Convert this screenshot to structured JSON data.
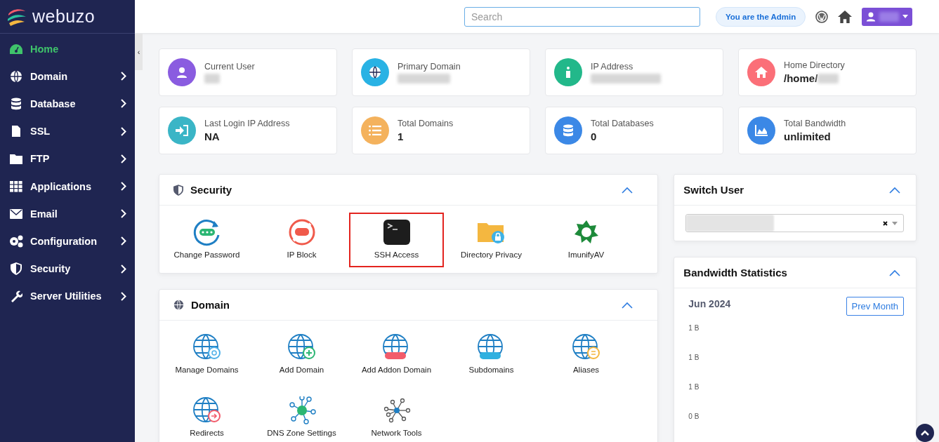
{
  "sidebar": {
    "logo": "webuzo",
    "collapse": "‹",
    "items": [
      {
        "label": "Home",
        "selected": true,
        "expandable": false
      },
      {
        "label": "Domain",
        "selected": false,
        "expandable": true
      },
      {
        "label": "Database",
        "selected": false,
        "expandable": true
      },
      {
        "label": "SSL",
        "selected": false,
        "expandable": true
      },
      {
        "label": "FTP",
        "selected": false,
        "expandable": true
      },
      {
        "label": "Applications",
        "selected": false,
        "expandable": true
      },
      {
        "label": "Email",
        "selected": false,
        "expandable": true
      },
      {
        "label": "Configuration",
        "selected": false,
        "expandable": true
      },
      {
        "label": "Security",
        "selected": false,
        "expandable": true
      },
      {
        "label": "Server Utilities",
        "selected": false,
        "expandable": true
      }
    ]
  },
  "topbar": {
    "search": {
      "placeholder": "Search"
    },
    "role_badge": "You are the Admin"
  },
  "stats": [
    {
      "label": "Current User",
      "color": "#8a5ce0"
    },
    {
      "label": "Primary Domain",
      "color": "#29b2e4"
    },
    {
      "label": "IP Address",
      "color": "#22b88a"
    },
    {
      "label": "Home Directory",
      "value": "/home/",
      "color": "#fb6f78"
    },
    {
      "label": "Last Login IP Address",
      "value": "NA",
      "color": "#3ab5c6"
    },
    {
      "label": "Total Domains",
      "value": "1",
      "color": "#f4b25d"
    },
    {
      "label": "Total Databases",
      "value": "0",
      "color": "#3b88e6"
    },
    {
      "label": "Total Bandwidth",
      "value": "unlimited",
      "color": "#3b88e6"
    }
  ],
  "sections": [
    {
      "title": "Security",
      "tools": [
        {
          "label": "Change Password",
          "highlighted": false
        },
        {
          "label": "IP Block",
          "highlighted": false
        },
        {
          "label": "SSH Access",
          "highlighted": true
        },
        {
          "label": "Directory Privacy",
          "highlighted": false
        },
        {
          "label": "ImunifyAV",
          "highlighted": false
        }
      ]
    },
    {
      "title": "Domain",
      "tools": [
        {
          "label": "Manage Domains",
          "highlighted": false
        },
        {
          "label": "Add Domain",
          "highlighted": false
        },
        {
          "label": "Add Addon Domain",
          "highlighted": false
        },
        {
          "label": "Subdomains",
          "highlighted": false
        },
        {
          "label": "Aliases",
          "highlighted": false
        },
        {
          "label": "Redirects",
          "highlighted": false
        },
        {
          "label": "DNS Zone Settings",
          "highlighted": false
        },
        {
          "label": "Network Tools",
          "highlighted": false
        }
      ]
    }
  ],
  "switch_user": {
    "title": "Switch User"
  },
  "bandwidth": {
    "title": "Bandwidth Statistics",
    "month": "Jun 2024",
    "button": "Prev Month",
    "y_labels": [
      "1 B",
      "1 B",
      "1 B",
      "0 B"
    ]
  }
}
